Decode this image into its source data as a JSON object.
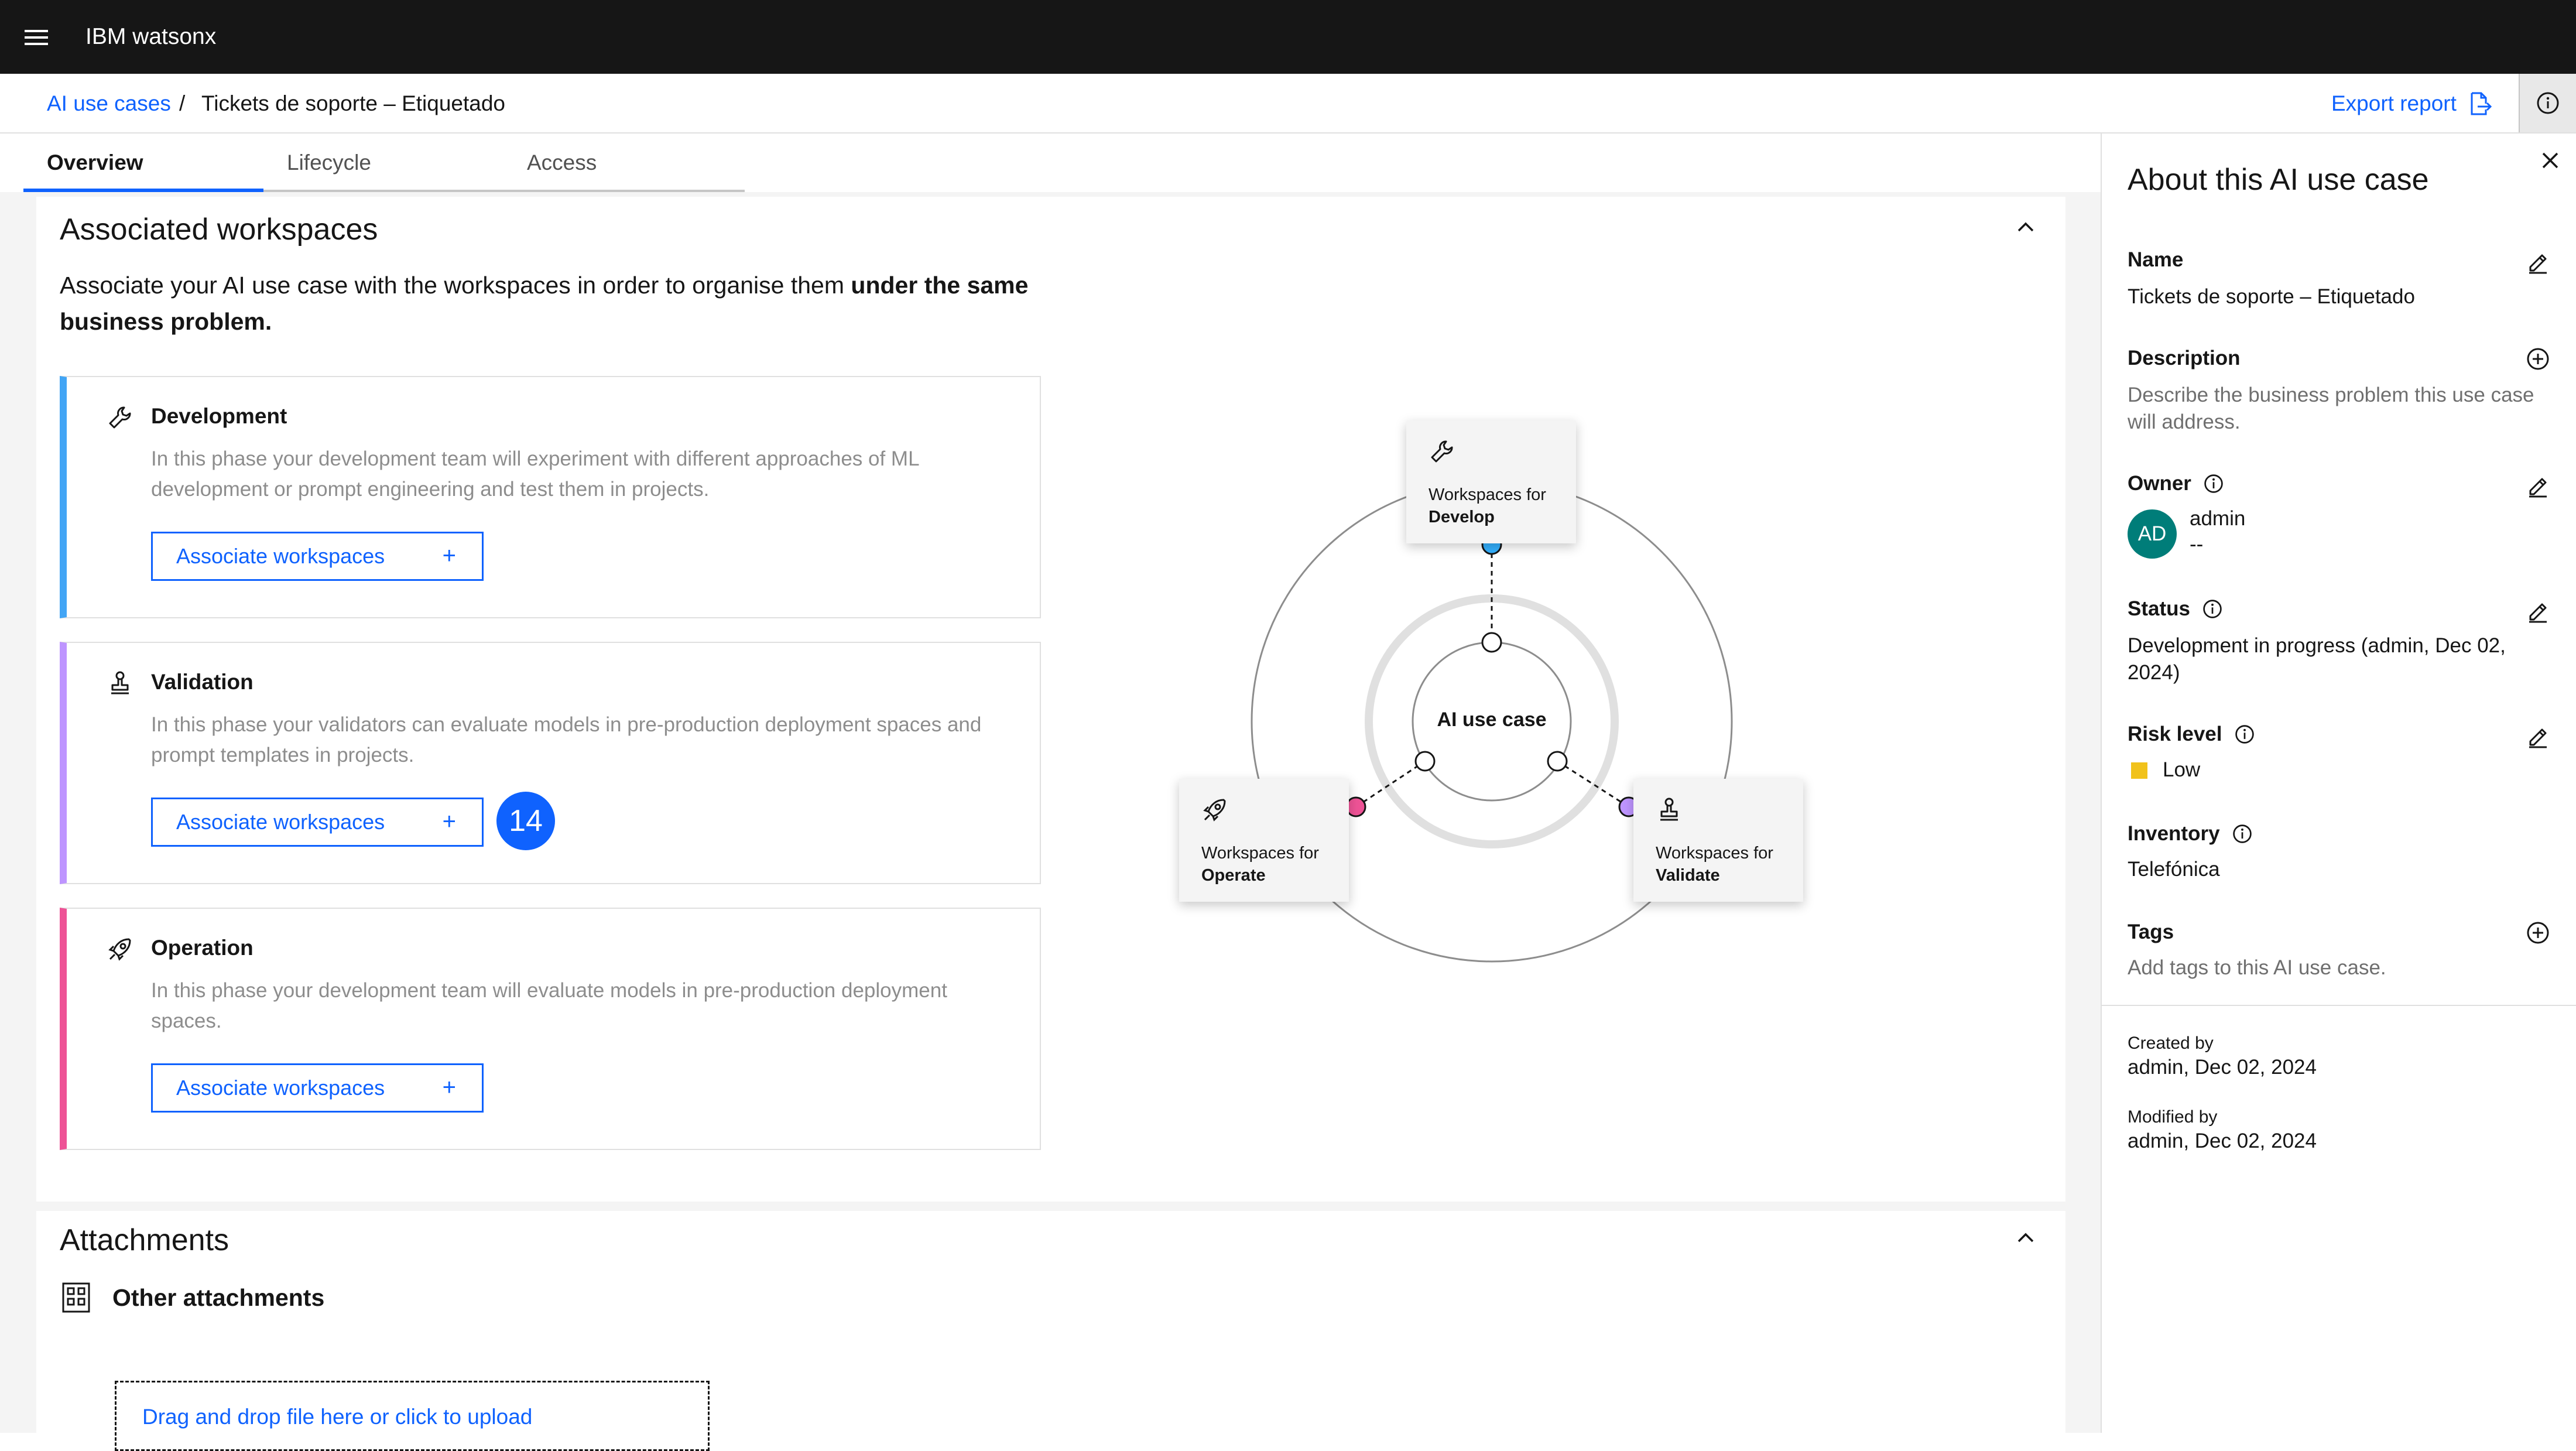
{
  "header": {
    "brand": "IBM watsonx"
  },
  "breadcrumb": {
    "parent": "AI use cases",
    "separator": "/",
    "current": "Tickets de soporte – Etiquetado"
  },
  "actions": {
    "export": "Export report"
  },
  "tabs": [
    {
      "label": "Overview",
      "active": true
    },
    {
      "label": "Lifecycle",
      "active": false
    },
    {
      "label": "Access",
      "active": false
    }
  ],
  "workspaces": {
    "title": "Associated workspaces",
    "intro": "Associate your AI use case with the workspaces in order to organise them ",
    "intro_bold": "under the same business problem.",
    "phases": [
      {
        "title": "Development",
        "description": "In this phase your development team will experiment with different approaches of ML development or prompt engineering and test them in projects.",
        "button": "Associate workspaces",
        "color": "#42a5f5",
        "icon": "wrench-icon"
      },
      {
        "title": "Validation",
        "description": "In this phase your validators can evaluate models in pre-production deployment spaces and prompt templates in projects.",
        "button": "Associate workspaces",
        "color": "#be95ff",
        "icon": "stamp-icon"
      },
      {
        "title": "Operation",
        "description": "In this phase your development team will evaluate models in pre-production deployment spaces.",
        "button": "Associate workspaces",
        "color": "#ee5396",
        "icon": "rocket-icon"
      }
    ],
    "plus": "+",
    "badge": "14",
    "diagram": {
      "center": "AI use case",
      "develop_prefix": "Workspaces for",
      "develop": "Develop",
      "operate_prefix": "Workspaces for",
      "operate": "Operate",
      "validate_prefix": "Workspaces for",
      "validate": "Validate",
      "colors": {
        "develop": "#33b1ff",
        "operate": "#ee5396",
        "validate": "#be95ff"
      }
    }
  },
  "attachments": {
    "title": "Attachments",
    "subtitle": "Other attachments",
    "dropzone": "Drag and drop file here or click to upload"
  },
  "panel": {
    "title": "About this AI use case",
    "name_label": "Name",
    "name_value": "Tickets de soporte – Etiquetado",
    "description_label": "Description",
    "description_value": "Describe the business problem this use case will address.",
    "owner_label": "Owner",
    "owner_initials": "AD",
    "owner_name": "admin",
    "owner_sub": "--",
    "status_label": "Status",
    "status_value": "Development in progress (admin, Dec 02, 2024)",
    "risk_label": "Risk level",
    "risk_value": "Low",
    "risk_color": "#f1c21b",
    "inventory_label": "Inventory",
    "inventory_value": "Telefónica",
    "tags_label": "Tags",
    "tags_value": "Add tags to this AI use case.",
    "created_label": "Created by",
    "created_value": "admin, Dec 02, 2024",
    "modified_label": "Modified by",
    "modified_value": "admin, Dec 02, 2024"
  }
}
